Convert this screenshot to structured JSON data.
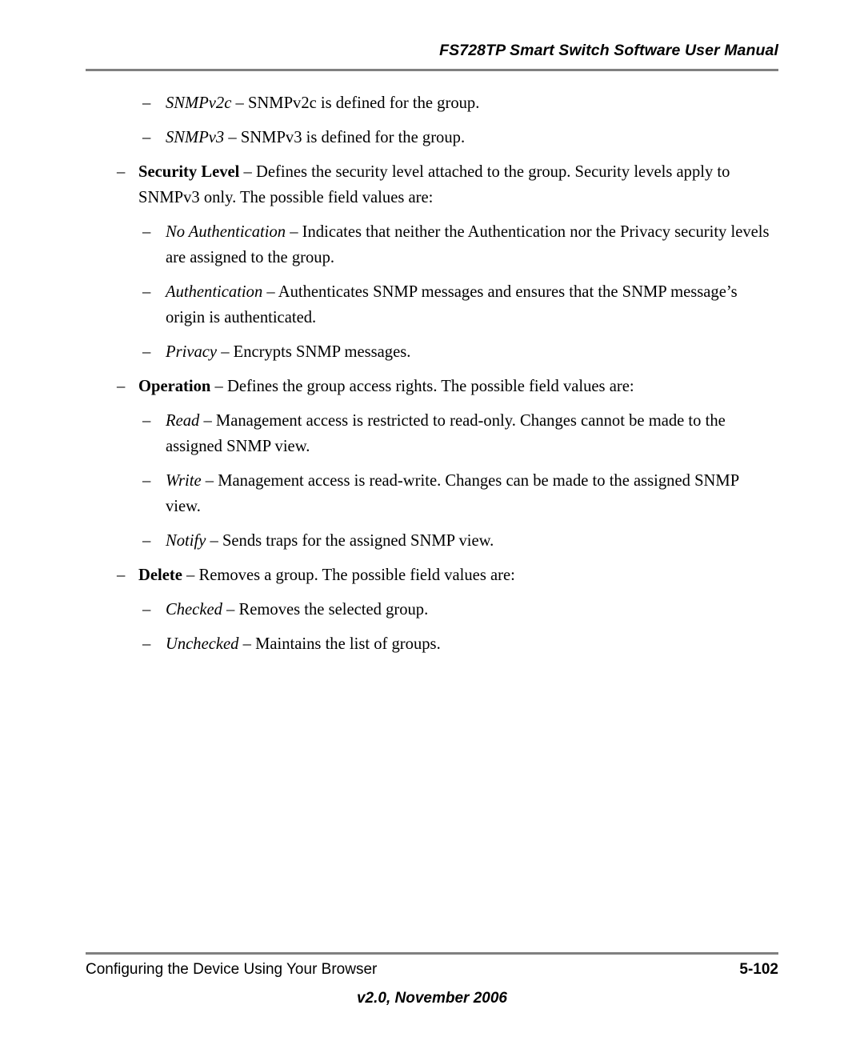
{
  "document": {
    "header_title": "FS728TP Smart Switch Software User Manual",
    "rule_color": "#808080"
  },
  "body": {
    "items": [
      {
        "level": 2,
        "dash": "–",
        "term": "SNMPv2c",
        "term_style": "italic",
        "separator": " – ",
        "text": "SNMPv2c is defined for the group."
      },
      {
        "level": 2,
        "dash": "–",
        "term": "SNMPv3",
        "term_style": "italic",
        "separator": " – ",
        "text": "SNMPv3 is defined for the group."
      },
      {
        "level": 1,
        "dash": "–",
        "term": "Security Level",
        "term_style": "bold",
        "separator": " – ",
        "text": "Defines the security level attached to the group. Security levels apply to SNMPv3 only. The possible field values are:"
      },
      {
        "level": 2,
        "dash": "–",
        "term": "No Authentication",
        "term_style": "italic",
        "separator": " – ",
        "text": "Indicates that neither the Authentication nor the Privacy security levels are assigned to the group."
      },
      {
        "level": 2,
        "dash": "–",
        "term": "Authentication",
        "term_style": "italic",
        "separator": " – ",
        "text": "Authenticates SNMP messages and ensures that the SNMP message’s origin is authenticated."
      },
      {
        "level": 2,
        "dash": "–",
        "term": "Privacy",
        "term_style": "italic",
        "separator": " – ",
        "text": "Encrypts SNMP messages."
      },
      {
        "level": 1,
        "dash": "–",
        "term": "Operation",
        "term_style": "bold",
        "separator": " – ",
        "text": "Defines the group access rights. The possible field values are:"
      },
      {
        "level": 2,
        "dash": "–",
        "term": "Read",
        "term_style": "italic",
        "separator": " – ",
        "text": "Management access is restricted to read-only. Changes cannot be made to the assigned SNMP view."
      },
      {
        "level": 2,
        "dash": "–",
        "term": "Write",
        "term_style": "italic",
        "separator": " – ",
        "text": "Management access is read-write. Changes can be made to the assigned SNMP view."
      },
      {
        "level": 2,
        "dash": "–",
        "term": "Notify",
        "term_style": "italic",
        "separator": " – ",
        "text": "Sends traps for the assigned SNMP view."
      },
      {
        "level": 1,
        "dash": "–",
        "term": "Delete",
        "term_style": "bold",
        "separator": " – ",
        "text": "Removes a group. The possible field values are:"
      },
      {
        "level": 2,
        "dash": "–",
        "term": "Checked",
        "term_style": "italic",
        "separator": " – ",
        "text": "Removes the selected group."
      },
      {
        "level": 2,
        "dash": "–",
        "term": "Unchecked",
        "term_style": "italic",
        "separator": " – ",
        "text": "Maintains the list of groups."
      }
    ]
  },
  "footer": {
    "left": "Configuring the Device Using Your Browser",
    "page_number": "5-102",
    "version": "v2.0, November 2006"
  }
}
